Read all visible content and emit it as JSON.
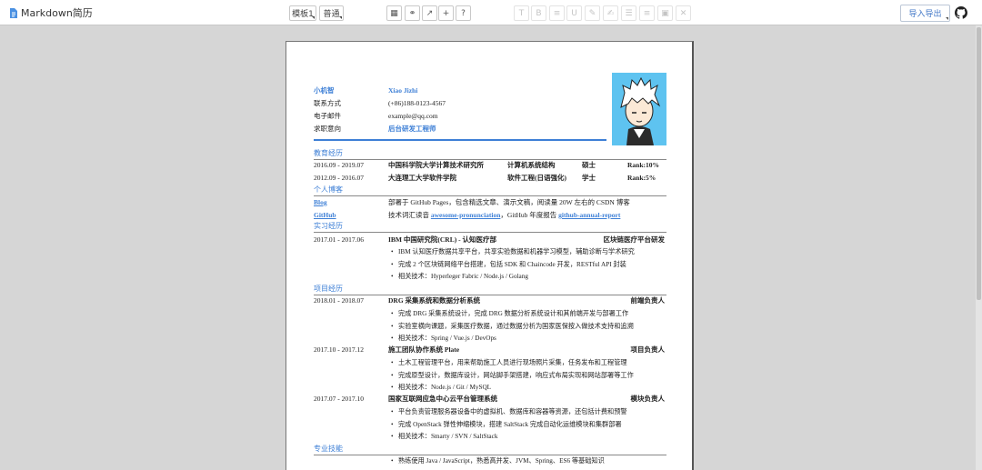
{
  "toolbar": {
    "app_name": "Markdown简历",
    "template_label": "模板1",
    "mode_label": "普通",
    "export_label": "导入导出",
    "icons": [
      "layout-icon",
      "paint-icon",
      "expand-icon",
      "plus-icon",
      "help-icon",
      "text-icon",
      "bold-icon",
      "list-icon",
      "underline-icon",
      "eraser-icon",
      "highlight-icon",
      "ordered-list-icon",
      "align-icon",
      "image-icon",
      "close-icon",
      "github-icon"
    ]
  },
  "resume": {
    "name_label": "小机智",
    "name_value": "Xiao Jizhi",
    "contact_label": "联系方式",
    "contact_value": "(+86)188-0123-4567",
    "email_label": "电子邮件",
    "email_value": "example@qq.com",
    "intent_label": "求职意向",
    "intent_value": "后台研发工程师",
    "sections": {
      "education": "教育经历",
      "blog": "个人博客",
      "internship": "实习经历",
      "projects": "项目经历",
      "skills": "专业技能"
    },
    "education": [
      {
        "date": "2016.09 - 2019.07",
        "school": "中国科学院大学计算技术研究所",
        "major": "计算机系统结构",
        "degree": "硕士",
        "rank": "Rank:10%"
      },
      {
        "date": "2012.09 - 2016.07",
        "school": "大连理工大学软件学院",
        "major": "软件工程(日语强化)",
        "degree": "学士",
        "rank": "Rank:5%"
      }
    ],
    "blog": {
      "blog_label": "Blog",
      "blog_text": "部署于 GitHub Pages，包含精选文章、演示文稿，阅读量 20W 左右的 CSDN 博客",
      "github_label": "GitHub",
      "github_text_1": "技术词汇读音",
      "github_link_1": "awesome-pronunciation",
      "github_text_2": "，GitHub 年度报告",
      "github_link_2": "github-annual-report"
    },
    "internship": {
      "date": "2017.01 - 2017.06",
      "title": "IBM 中国研究院(CRL) - 认知医疗部",
      "role": "区块链医疗平台研发",
      "bullets": [
        "IBM 认知医疗数据共享平台，共享实验数据和机器学习模型，辅助诊断与学术研究",
        "完成 2 个区块链网络平台搭建，包括 SDK 和 Chaincode 开发，RESTful API 封装",
        "相关技术：Hyperleger Fabric / Node.js / Golang"
      ]
    },
    "projects": [
      {
        "date": "2018.01 - 2018.07",
        "title": "DRG 采集系统和数据分析系统",
        "role": "前端负责人",
        "bullets": [
          "完成 DRG 采集系统设计，完成 DRG 数据分析系统设计和其前端开发与部署工作",
          "实验室横向课题，采集医疗数据，通过数据分析为国家医保按入做技术支持和追溯",
          "相关技术：Spring / Vue.js / DevOps"
        ]
      },
      {
        "date": "2017.10 - 2017.12",
        "title": "施工团队协作系统 Plate",
        "role": "项目负责人",
        "bullets": [
          "土木工程管理平台，用来帮助施工人员进行现场照片采集，任务发布和工程管理",
          "完成原型设计，数据库设计，网站脚手架搭建，响应式布局实现和网站部署等工作",
          "相关技术：Node.js / Git / MySQL"
        ]
      },
      {
        "date": "2017.07 - 2017.10",
        "title": "国家互联网应急中心云平台管理系统",
        "role": "模块负责人",
        "bullets": [
          "平台负责管理服务器设备中的虚拟机、数据库和容器等资源，还包括计费和预警",
          "完成 OpenStack 弹性伸缩模块，搭建 SaltStack 完成自动化运维模块和集群部署",
          "相关技术：Smarty / SVN / SaltStack"
        ]
      }
    ],
    "skills": [
      "熟练使用 Java / JavaScript，熟悉高并发、JVM、Spring、ES6 等基础知识"
    ]
  },
  "colors": {
    "accent": "#3d7fd6",
    "background": "#d6d6d6"
  }
}
